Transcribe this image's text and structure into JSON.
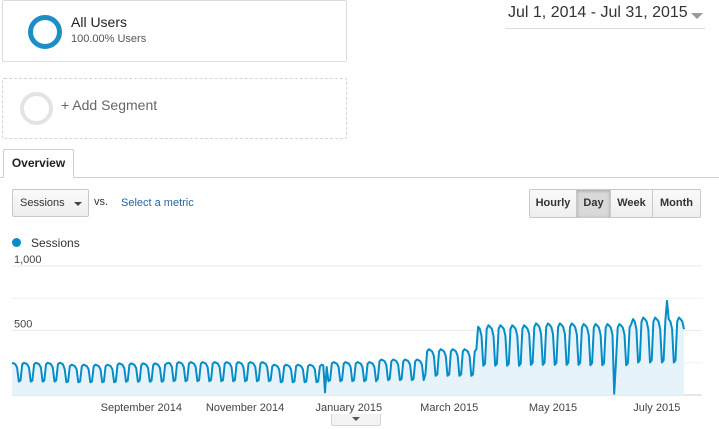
{
  "segments": {
    "active": {
      "title": "All Users",
      "subtitle": "100.00% Users"
    },
    "add": {
      "label": "+ Add Segment"
    }
  },
  "date_range": {
    "label": "Jul 1, 2014 - Jul 31, 2015"
  },
  "tabs": [
    {
      "label": "Overview",
      "active": true
    }
  ],
  "toolbar": {
    "metric": "Sessions",
    "vs_label": "vs.",
    "select_metric": "Select a metric",
    "granularity": [
      {
        "label": "Hourly",
        "active": false
      },
      {
        "label": "Day",
        "active": true
      },
      {
        "label": "Week",
        "active": false
      },
      {
        "label": "Month",
        "active": false
      }
    ]
  },
  "legend": {
    "label": "Sessions",
    "color": "#058dc7"
  },
  "chart_data": {
    "type": "area",
    "series": [
      {
        "name": "Sessions",
        "color": "#058dc7",
        "fill": "#e6f3fa",
        "x_start": "2014-07-01",
        "x_end": "2015-07-31",
        "weekly_pattern": [
          0.95,
          1.0,
          0.98,
          0.95,
          0.85,
          0.42,
          0.45
        ],
        "monthly_weekday_level": [
          {
            "month": "2014-07",
            "sessions": 250
          },
          {
            "month": "2014-08",
            "sessions": 235
          },
          {
            "month": "2014-09",
            "sessions": 245
          },
          {
            "month": "2014-10",
            "sessions": 255
          },
          {
            "month": "2014-11",
            "sessions": 255
          },
          {
            "month": "2014-12",
            "sessions": 235
          },
          {
            "month": "2015-01",
            "sessions": 255
          },
          {
            "month": "2015-02",
            "sessions": 275
          },
          {
            "month": "2015-03",
            "sessions": 355
          },
          {
            "month": "2015-04",
            "sessions": 540
          },
          {
            "month": "2015-05",
            "sessions": 555
          },
          {
            "month": "2015-06",
            "sessions": 550
          },
          {
            "month": "2015-07",
            "sessions": 600
          }
        ],
        "notable_points": [
          {
            "date": "2015-01-01",
            "sessions": 20
          },
          {
            "date": "2015-06-20",
            "sessions": 10
          },
          {
            "date": "2015-07-21",
            "sessions": 730
          }
        ]
      }
    ],
    "y_ticks": [
      {
        "value": 1000,
        "label": "1,000"
      },
      {
        "value": 500,
        "label": "500"
      }
    ],
    "ylim": [
      0,
      1000
    ],
    "x_ticks": [
      {
        "date": "2014-09-15",
        "label": "September 2014"
      },
      {
        "date": "2014-11-15",
        "label": "November 2014"
      },
      {
        "date": "2015-01-15",
        "label": "January 2015"
      },
      {
        "date": "2015-03-15",
        "label": "March 2015"
      },
      {
        "date": "2015-05-15",
        "label": "May 2015"
      },
      {
        "date": "2015-07-15",
        "label": "July 2015"
      }
    ],
    "grid": true,
    "legend_position": "top-left"
  }
}
